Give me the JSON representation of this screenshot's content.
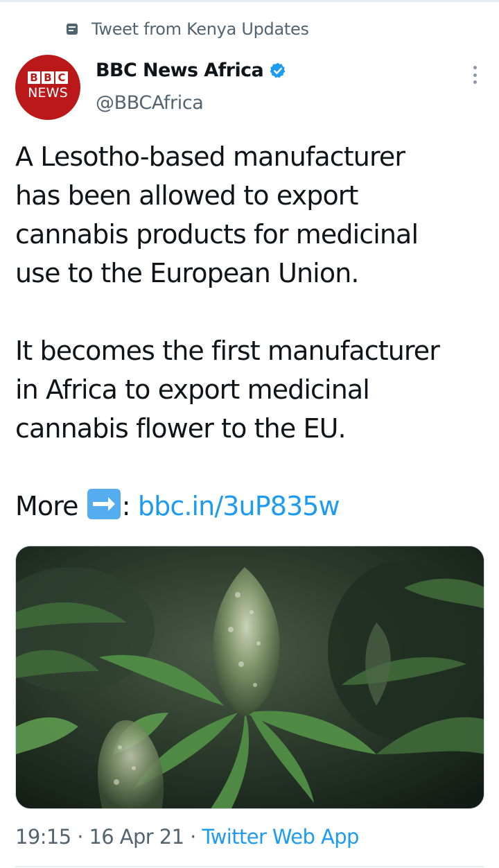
{
  "social_context": {
    "icon": "tweet-document-icon",
    "text": "Tweet from Kenya Updates"
  },
  "author": {
    "avatar": {
      "letters": [
        "B",
        "B",
        "C"
      ],
      "word": "NEWS",
      "color": "#bb1919"
    },
    "name": "BBC News Africa",
    "verified": true,
    "handle": "@BBCAfrica"
  },
  "tweet": {
    "lines_paragraph_1": [
      "A Lesotho-based manufacturer",
      "has been allowed to export",
      "cannabis products for medicinal",
      "use to the European Union."
    ],
    "lines_paragraph_2": [
      "It becomes the first manufacturer",
      "in Africa to export medicinal",
      "cannabis flower to the EU."
    ],
    "more_prefix": "More",
    "more_emoji": "right-arrow-emoji",
    "more_colon": ":",
    "link": "bbc.in/3uP835w"
  },
  "media": {
    "icon": "cannabis-plant-photo"
  },
  "meta": {
    "time": "19:15",
    "separator": " · ",
    "date": "16 Apr 21",
    "source": "Twitter Web App"
  },
  "colors": {
    "text": "#0f1419",
    "secondary": "#536471",
    "link": "#1d9bf0",
    "bbc_red": "#bb1919"
  }
}
